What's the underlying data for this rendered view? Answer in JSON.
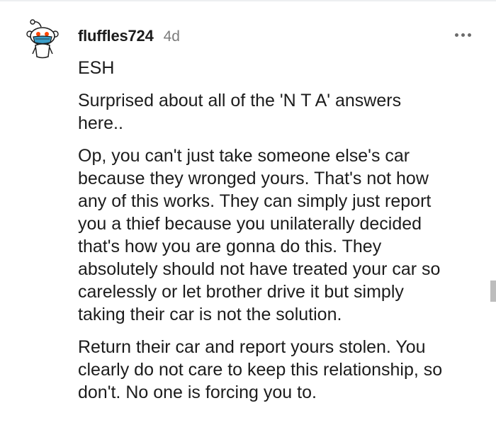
{
  "comment": {
    "username": "fluffles724",
    "timestamp": "4d",
    "avatar_icon": "reddit-snoo-mask-avatar-icon",
    "more_icon": "more-options-icon",
    "paragraphs": [
      "ESH",
      "Surprised about all of the 'N T A' answers\nhere..",
      "Op, you can't just take someone else's car\nbecause they wronged yours. That's not how\nany of this works. They can simply just report\nyou a thief because you unilaterally decided\nthat's how you are gonna do this. They\nabsolutely should not have treated your car so\ncarelessly or let brother drive it but simply\ntaking their car is not the solution.",
      "Return their car and report yours stolen. You\nclearly do not care to keep this relationship, so\ndon't. No one is forcing you to."
    ]
  },
  "colors": {
    "text": "#1c1c1c",
    "meta": "#7c7c7c",
    "mask": "#3a9ec9"
  }
}
